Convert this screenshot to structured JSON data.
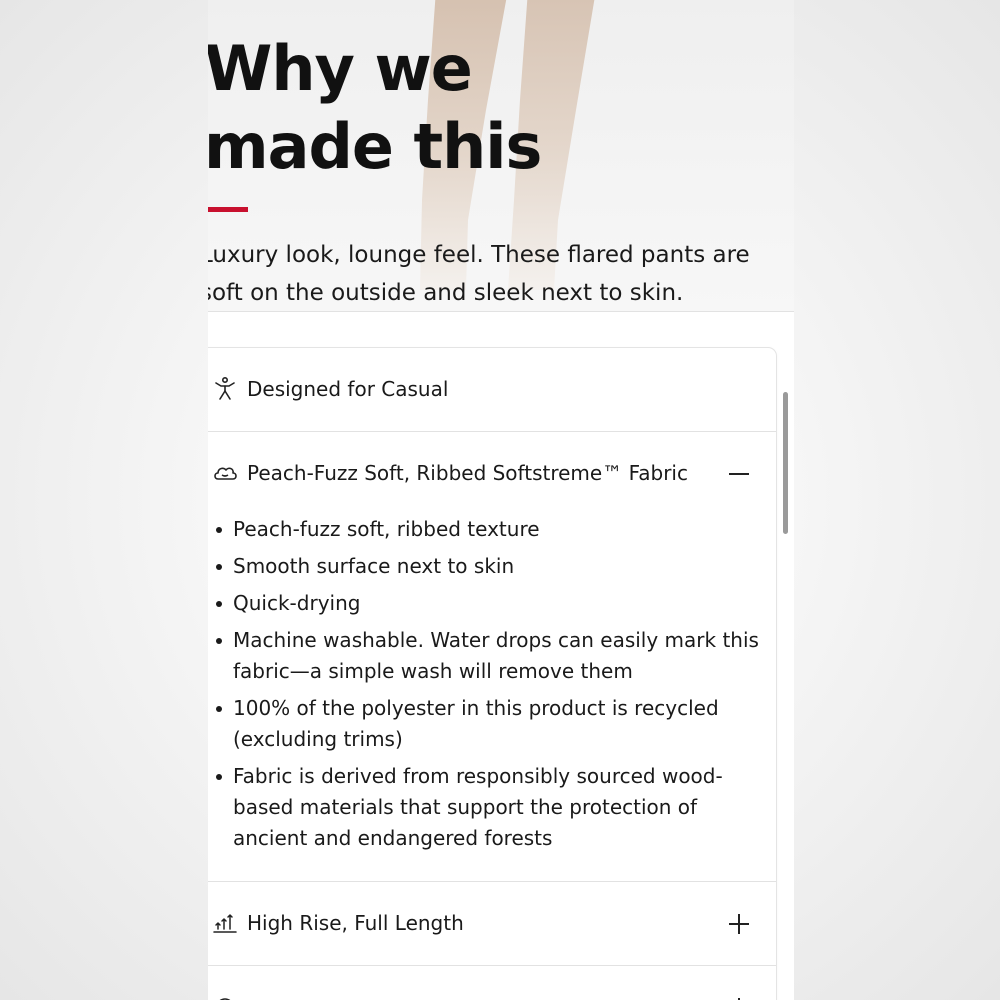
{
  "hero": {
    "title_line1": "Why we",
    "title_line2": "made this",
    "description_line1": "Luxury look, lounge feel. These flared pants are",
    "description_line2": "soft on the outside and sleek next to skin.",
    "accent_color": "#c8102e"
  },
  "features": {
    "items": [
      {
        "label": "Designed for Casual",
        "icon": "person-activity-icon",
        "toggle": ""
      },
      {
        "label": "Peach-Fuzz Soft, Ribbed Softstreme™ Fabric",
        "icon": "cloud-icon",
        "toggle": "minus",
        "expanded": true,
        "bullets": [
          "Peach-fuzz soft, ribbed texture",
          "Smooth surface next to skin",
          "Quick-drying",
          "Machine washable. Water drops can easily mark this fabric—a simple wash will remove them",
          "100% of the polyester in this product is recycled (excluding trims)",
          "Fabric is derived from responsibly sourced wood-based materials that support the protection of ancient and endangered forests"
        ]
      },
      {
        "label": "High Rise, Full Length",
        "icon": "rise-arrows-icon",
        "toggle": "plus"
      }
    ]
  }
}
